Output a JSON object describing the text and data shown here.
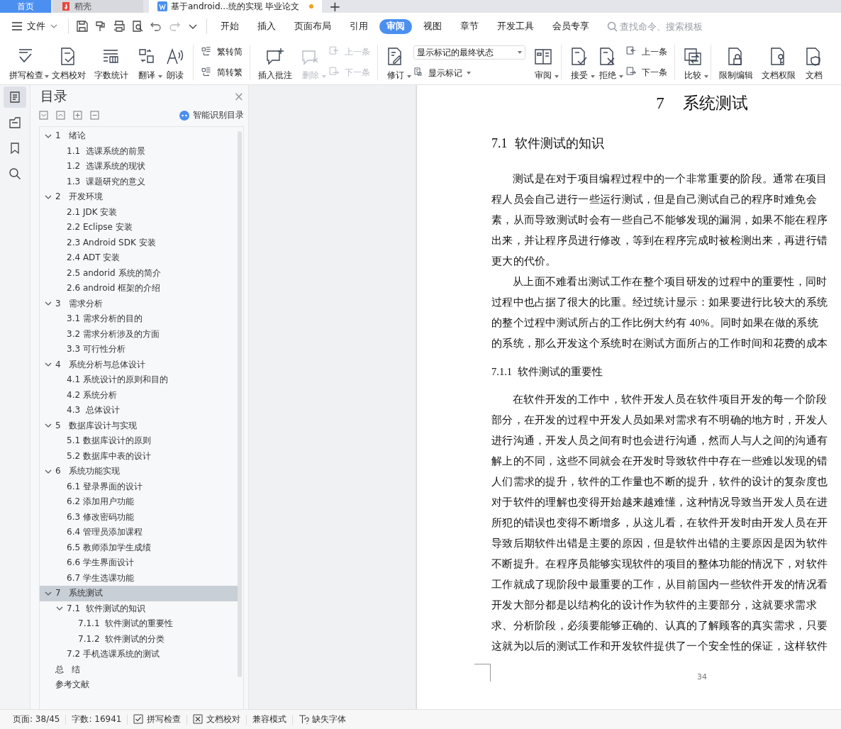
{
  "tabs": [
    {
      "label": "首页",
      "kind": "home",
      "selected": false,
      "modified": false
    },
    {
      "label": "稻壳",
      "kind": "app",
      "selected": false,
      "modified": false
    },
    {
      "label": "基于android...统的实现 毕业论文",
      "kind": "doc",
      "selected": true,
      "modified": true
    }
  ],
  "new_tab": "+",
  "menu": {
    "file": "文件",
    "tabs": [
      {
        "label": "开始",
        "selected": false
      },
      {
        "label": "插入",
        "selected": false
      },
      {
        "label": "页面布局",
        "selected": false
      },
      {
        "label": "引用",
        "selected": false
      },
      {
        "label": "审阅",
        "selected": true
      },
      {
        "label": "视图",
        "selected": false
      },
      {
        "label": "章节",
        "selected": false
      },
      {
        "label": "开发工具",
        "selected": false
      },
      {
        "label": "会员专享",
        "selected": false
      }
    ],
    "search": {
      "placeholder": "查找命令、搜索模板"
    }
  },
  "ribbon": [
    {
      "items": [
        {
          "kind": "big",
          "label": "拼写检查",
          "dropdown": true,
          "disabled": false
        },
        {
          "kind": "big",
          "label": "文档校对",
          "dropdown": false,
          "disabled": false
        },
        {
          "kind": "big",
          "label": "字数统计",
          "dropdown": false,
          "disabled": false
        },
        {
          "kind": "big",
          "label": "翻译",
          "dropdown": true,
          "disabled": false
        },
        {
          "kind": "big",
          "label": "朗读",
          "dropdown": false,
          "disabled": false
        }
      ]
    },
    {
      "items": [
        {
          "kind": "stack",
          "rows": [
            {
              "label": "繁转简",
              "disabled": false
            },
            {
              "label": "简转繁",
              "disabled": false
            }
          ]
        }
      ]
    },
    {
      "items": [
        {
          "kind": "big",
          "label": "插入批注",
          "dropdown": false,
          "disabled": false
        },
        {
          "kind": "big",
          "label": "删除",
          "dropdown": true,
          "disabled": true
        },
        {
          "kind": "stack",
          "rows": [
            {
              "label": "上一条",
              "disabled": true
            },
            {
              "label": "下一条",
              "disabled": true
            }
          ]
        }
      ]
    },
    {
      "items": [
        {
          "kind": "big",
          "label": "修订",
          "dropdown": true,
          "disabled": false
        },
        {
          "kind": "combo",
          "value": "显示标记的最终状态",
          "sub": {
            "label": "显示标记",
            "dropdown": true
          }
        },
        {
          "kind": "big",
          "label": "审阅",
          "dropdown": true,
          "disabled": false
        }
      ]
    },
    {
      "items": [
        {
          "kind": "big",
          "label": "接受",
          "dropdown": true,
          "disabled": false
        },
        {
          "kind": "big",
          "label": "拒绝",
          "dropdown": true,
          "disabled": false
        },
        {
          "kind": "stack",
          "rows": [
            {
              "label": "上一条",
              "disabled": false
            },
            {
              "label": "下一条",
              "disabled": false
            }
          ]
        }
      ]
    },
    {
      "items": [
        {
          "kind": "big",
          "label": "比较",
          "dropdown": true,
          "disabled": false
        }
      ]
    },
    {
      "items": [
        {
          "kind": "big",
          "label": "限制编辑",
          "dropdown": false,
          "disabled": false
        },
        {
          "kind": "big",
          "label": "文档权限",
          "dropdown": false,
          "disabled": false
        },
        {
          "kind": "big",
          "label": "文档",
          "dropdown": false,
          "disabled": false
        }
      ]
    }
  ],
  "nav": {
    "rail": [
      {
        "selected": true
      },
      {
        "selected": false
      },
      {
        "selected": false
      },
      {
        "selected": false
      }
    ],
    "title": "目录",
    "close": "×",
    "smart": "智能识别目录",
    "toc": [
      {
        "label": "1   绪论",
        "selected": false,
        "expanded": true,
        "children": [
          {
            "label": "1.1  选课系统的前景",
            "selected": false
          },
          {
            "label": "1.2  选课系统的现状",
            "selected": false
          },
          {
            "label": "1.3  课题研究的意义",
            "selected": false
          }
        ]
      },
      {
        "label": "2   开发环境",
        "selected": false,
        "expanded": true,
        "children": [
          {
            "label": "2.1 JDK 安装",
            "selected": false
          },
          {
            "label": "2.2 Eclipse 安装",
            "selected": false
          },
          {
            "label": "2.3 Android SDK 安装",
            "selected": false
          },
          {
            "label": "2.4 ADT 安装",
            "selected": false
          },
          {
            "label": "2.5 andorid 系统的简介",
            "selected": false
          },
          {
            "label": "2.6 android 框架的介绍",
            "selected": false
          }
        ]
      },
      {
        "label": "3   需求分析",
        "selected": false,
        "expanded": true,
        "children": [
          {
            "label": "3.1 需求分析的目的",
            "selected": false
          },
          {
            "label": "3.2 需求分析涉及的方面",
            "selected": false
          },
          {
            "label": "3.3 可行性分析",
            "selected": false
          }
        ]
      },
      {
        "label": "4   系统分析与总体设计",
        "selected": false,
        "expanded": true,
        "children": [
          {
            "label": "4.1 系统设计的原则和目的",
            "selected": false
          },
          {
            "label": "4.2 系统分析",
            "selected": false
          },
          {
            "label": "4.3  总体设计",
            "selected": false
          }
        ]
      },
      {
        "label": "5   数据库设计与实现",
        "selected": false,
        "expanded": true,
        "children": [
          {
            "label": "5.1 数据库设计的原则",
            "selected": false
          },
          {
            "label": "5.2 数据库中表的设计",
            "selected": false
          }
        ]
      },
      {
        "label": "6   系统功能实现",
        "selected": false,
        "expanded": true,
        "children": [
          {
            "label": "6.1 登录界面的设计",
            "selected": false
          },
          {
            "label": "6.2 添加用户功能",
            "selected": false
          },
          {
            "label": "6.3 修改密码功能",
            "selected": false
          },
          {
            "label": "6.4 管理员添加课程",
            "selected": false
          },
          {
            "label": "6.5 教师添加学生成绩",
            "selected": false
          },
          {
            "label": "6.6 学生界面设计",
            "selected": false
          },
          {
            "label": "6.7 学生选课功能",
            "selected": false
          }
        ]
      },
      {
        "label": "7   系统测试",
        "selected": true,
        "expanded": true,
        "children": [
          {
            "label": "7.1  软件测试的知识",
            "selected": false,
            "expanded": true,
            "children": [
              {
                "label": "7.1.1  软件测试的重要性",
                "selected": false
              },
              {
                "label": "7.1.2  软件测试的分类",
                "selected": false
              }
            ]
          },
          {
            "label": "7.2 手机选课系统的测试",
            "selected": false
          }
        ]
      },
      {
        "label": "总   结",
        "selected": false
      },
      {
        "label": "参考文献",
        "selected": false
      }
    ]
  },
  "document": {
    "blocks": [
      {
        "kind": "h1",
        "number": "7",
        "text": "系统测试"
      },
      {
        "kind": "h2",
        "number": "7.1",
        "text": "软件测试的知识"
      },
      {
        "kind": "para",
        "lines": [
          "测试是在对于项目编程过程中的一个非常重要的阶段。通常在项目",
          "程人员会自己进行一些运行测试，但是自己测试自己的程序时难免会",
          "素，从而导致测试时会有一些自己不能够发现的漏洞，如果不能在程序",
          "出来，并让程序员进行修改，等到在程序完成时被检测出来，再进行错",
          "更大的代价。"
        ]
      },
      {
        "kind": "para",
        "lines": [
          "从上面不难看出测试工作在整个项目研发的过程中的重要性，同时",
          "过程中也占据了很大的比重。经过统计显示：如果要进行比较大的系统",
          "的整个过程中测试所占的工作比例大约有 40%。同时如果在做的系统",
          "的系统，那么开发这个系统时在测试方面所占的工作时间和花费的成本"
        ]
      },
      {
        "kind": "h3",
        "number": "7.1.1",
        "text": "软件测试的重要性"
      },
      {
        "kind": "para",
        "lines": [
          "在软件开发的工作中，软件开发人员在软件项目开发的每一个阶段",
          "部分，在开发的过程中开发人员如果对需求有不明确的地方时，开发人",
          "进行沟通，开发人员之间有时也会进行沟通，然而人与人之间的沟通有",
          "解上的不同，这些不同就会在开发时导致软件中存在一些难以发现的错",
          "人们需求的提升，软件的工作量也不断的提升，软件的设计的复杂度也",
          "对于软件的理解也变得开始越来越难懂，这种情况导致当开发人员在进",
          "所犯的错误也变得不断增多，从这儿看，在软件开发时由开发人员在开",
          "导致后期软件出错是主要的原因，但是软件出错的主要原因是因为软件",
          "不断提升。在程序员能够实现软件的项目的整体功能的情况下，对软件",
          "工作就成了现阶段中最重要的工作，从目前国内一些软件开发的情况看",
          "开发大部分都是以结构化的设计作为软件的主要部分，这就要求需求",
          "求、分析阶段，必须要能够正确的、认真的了解顾客的真实需求，只要",
          "这就为以后的测试工作和开发软件提供了一个安全性的保证，这样软件"
        ]
      }
    ],
    "page_number": "34"
  },
  "status_bar": [
    {
      "kind": "text",
      "label": "页面: 38/45"
    },
    {
      "kind": "text",
      "label": "字数: 16941"
    },
    {
      "kind": "check",
      "label": "拼写检查"
    },
    {
      "kind": "proof",
      "label": "文档校对"
    },
    {
      "kind": "plain",
      "label": "兼容模式"
    },
    {
      "kind": "font",
      "label": "缺失字体"
    }
  ]
}
